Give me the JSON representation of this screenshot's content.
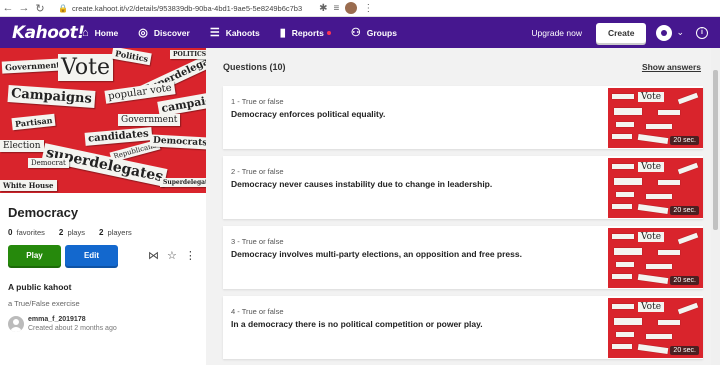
{
  "browser": {
    "url": "create.kahoot.it/v2/details/953839db-90ba-4bd1-9ae5-5e8249b6c7b3"
  },
  "nav": {
    "logo": "Kahoot!",
    "items": [
      {
        "label": "Home",
        "icon": "home-icon",
        "glyph": "⌂"
      },
      {
        "label": "Discover",
        "icon": "compass-icon",
        "glyph": "◎"
      },
      {
        "label": "Kahoots",
        "icon": "list-icon",
        "glyph": "☰"
      },
      {
        "label": "Reports",
        "icon": "bar-chart-icon",
        "glyph": "▮"
      },
      {
        "label": "Groups",
        "icon": "groups-icon",
        "glyph": "⚇"
      }
    ],
    "upgrade": "Upgrade now",
    "create": "Create"
  },
  "kahoot": {
    "title": "Democracy",
    "favorites_count": "0",
    "favorites_label": "favorites",
    "plays_count": "2",
    "plays_label": "plays",
    "players_count": "2",
    "players_label": "players",
    "play_button": "Play",
    "edit_button": "Edit",
    "visibility": "A public kahoot",
    "description": "a True/False exercise",
    "creator": "emma_f_2019178",
    "created": "Created about 2 months ago"
  },
  "cover_clippings": [
    "Government",
    "Vote",
    "Politics",
    "Superdelegates",
    "POLITICS",
    "Campaigns",
    "popular vote",
    "campaign",
    "Partisan",
    "Government",
    "candidates",
    "Election",
    "Republicans",
    "Democrats",
    "superdelegates",
    "Democrat",
    "White House",
    "Superdelegates"
  ],
  "questions_header": {
    "count_label": "Questions (10)",
    "show_answers": "Show answers"
  },
  "questions": [
    {
      "type": "1 - True or false",
      "text": "Democracy enforces political equality.",
      "time": "20 sec."
    },
    {
      "type": "2 - True or false",
      "text": "Democracy never causes instability due to change in leadership.",
      "time": "20 sec."
    },
    {
      "type": "3 - True or false",
      "text": "Democracy involves multi-party elections, an opposition and free press.",
      "time": "20 sec."
    },
    {
      "type": "4 - True or false",
      "text": "In a democracy there is no political competition or power play.",
      "time": "20 sec."
    }
  ],
  "thumb_word": "Vote",
  "colors": {
    "brand_purple": "#46178f",
    "play_green": "#26890c",
    "edit_blue": "#1368ce",
    "cover_red": "#d9242c",
    "reports_dot": "#ff3355"
  }
}
